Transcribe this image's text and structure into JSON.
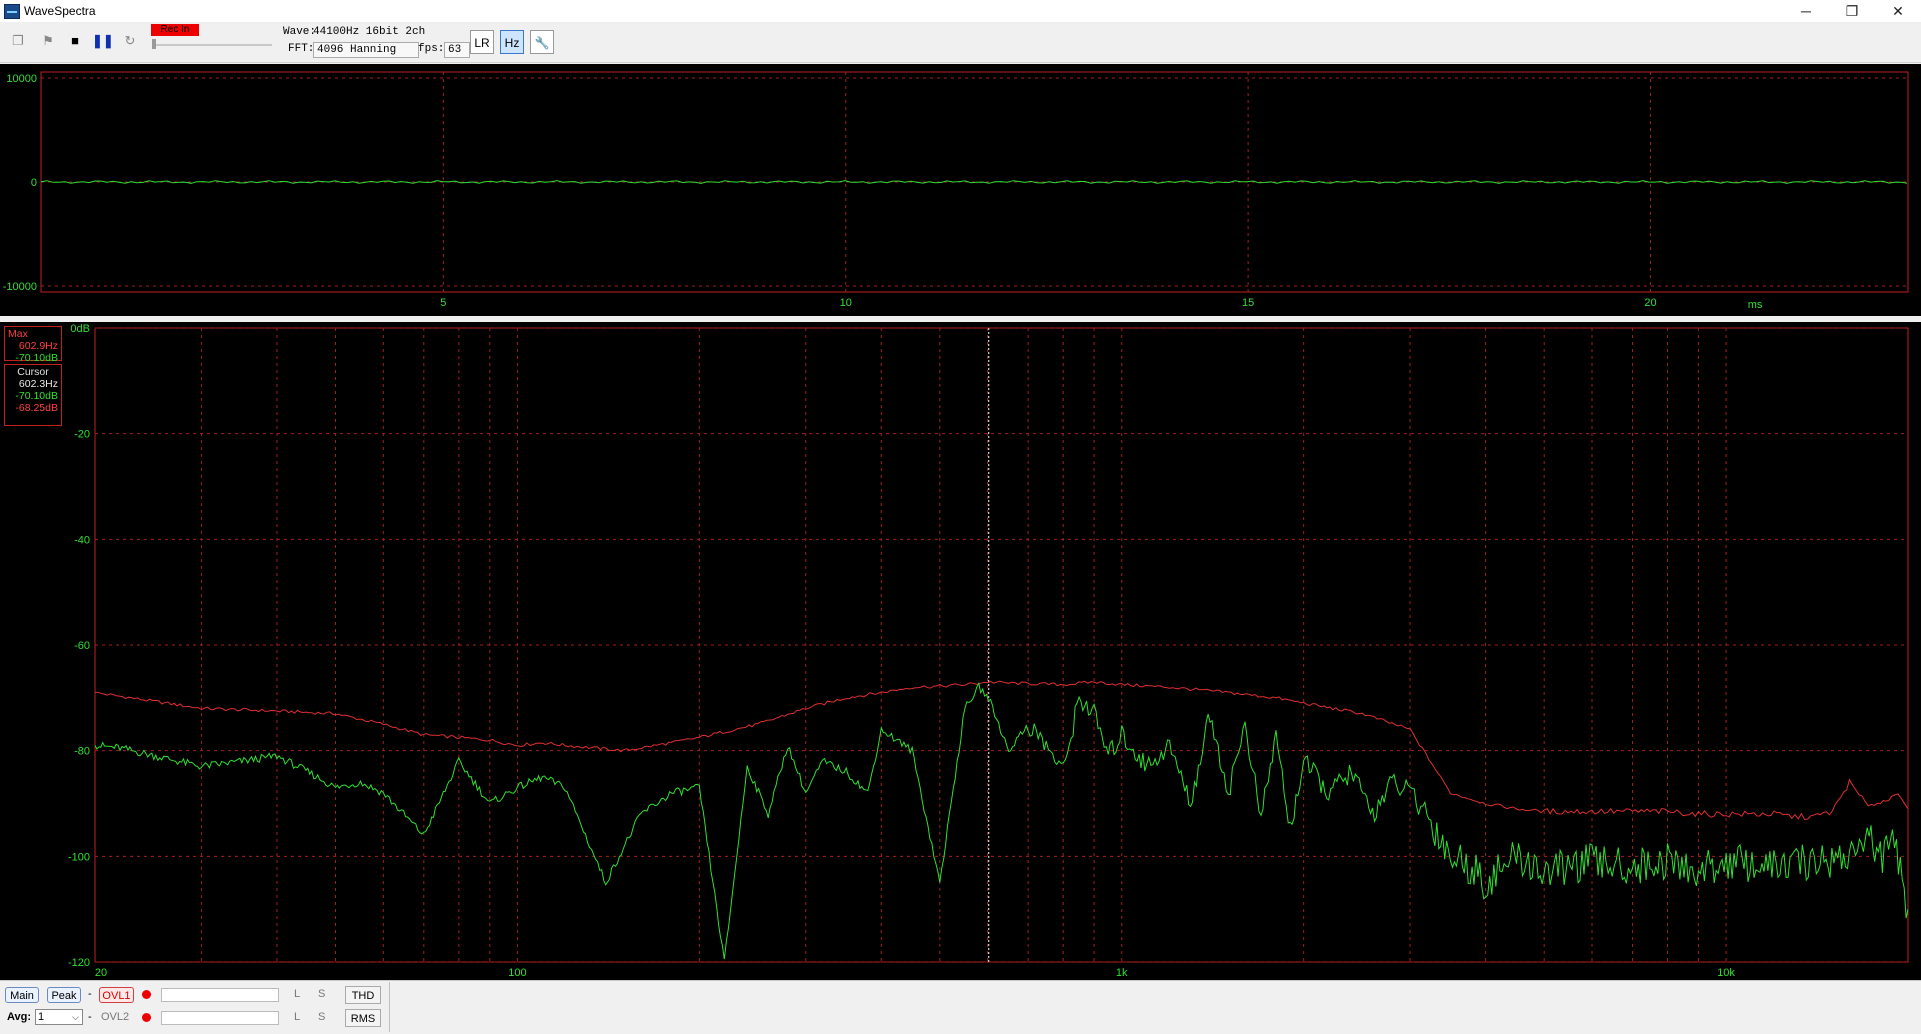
{
  "window": {
    "title": "WaveSpectra",
    "minimize_glyph": "─",
    "maximize_glyph": "❐",
    "close_glyph": "✕"
  },
  "toolbar": {
    "rec_label": "Rec In",
    "wave_label": "Wave:",
    "wave_value": "44100Hz 16bit 2ch",
    "fft_label": "FFT:",
    "fft_value": "4096 Hanning",
    "fps_label": "fps:",
    "fps_value": "63",
    "lr_button": "LR",
    "hz_button": "Hz",
    "settings_button": "🔧",
    "icons": [
      "copy-icon",
      "flag-icon",
      "stop-icon",
      "pause-icon",
      "repeat-icon"
    ]
  },
  "wave_panel": {
    "y_ticks": [
      "10000",
      "0",
      "-10000"
    ],
    "x_ticks": [
      "5",
      "10",
      "15",
      "20"
    ],
    "x_unit": "ms"
  },
  "spectrum_panel": {
    "y_ticks": [
      "0dB",
      "-20",
      "-40",
      "-60",
      "-80",
      "-100",
      "-120"
    ],
    "x_ticks": [
      "20",
      "100",
      "1k",
      "10k"
    ]
  },
  "max_box": {
    "label": "Max",
    "freq": "602.9Hz",
    "level": "-70.10dB"
  },
  "cursor_box": {
    "label": "Cursor",
    "freq": "602.3Hz",
    "level_l": "-70.10dB",
    "level_r": "-68.25dB"
  },
  "statusbar": {
    "main_button": "Main",
    "peak_button": "Peak",
    "dash": "-",
    "ovl1": "OVL1",
    "ovl2": "OVL2",
    "l": "L",
    "s": "S",
    "thd_button": "THD",
    "rms_button": "RMS",
    "avg_label": "Avg:",
    "avg_value": "1"
  },
  "chart_data": {
    "type": "line",
    "xscale": "log",
    "xlim": [
      20,
      20000
    ],
    "ylim": [
      -120,
      0
    ],
    "grid": true,
    "series": [
      {
        "color": "#e03030",
        "x": [
          20,
          30,
          40,
          50,
          60,
          70,
          80,
          90,
          100,
          110,
          120,
          150,
          180,
          200,
          250,
          300,
          350,
          400,
          450,
          500,
          550,
          600,
          650,
          700,
          800,
          900,
          1000,
          1200,
          1500,
          1800,
          2000,
          2500,
          3000,
          3500,
          4000,
          4500,
          5000,
          6000,
          7000,
          8000,
          9000,
          10000,
          11000,
          12000,
          13000,
          14000,
          15000,
          16000,
          17000,
          18000,
          19000,
          20000
        ],
        "y": [
          -69,
          -72,
          -72.5,
          -73,
          -75,
          -77,
          -77.5,
          -78,
          -79,
          -78.5,
          -79,
          -80,
          -78.5,
          -77.5,
          -75,
          -72,
          -70,
          -69,
          -68,
          -67.8,
          -67.5,
          -67,
          -67.2,
          -67.3,
          -67.5,
          -67,
          -67.5,
          -68,
          -69,
          -70,
          -71,
          -73,
          -76,
          -88,
          -90,
          -91,
          -91.5,
          -91.5,
          -91.5,
          -91.5,
          -92,
          -92,
          -92,
          -92,
          -92.5,
          -92.5,
          -91.5,
          -86,
          -90,
          -90,
          -88,
          -91
        ]
      },
      {
        "color": "#30e030",
        "x": [
          20,
          22,
          30,
          35,
          40,
          45,
          50,
          55,
          60,
          70,
          80,
          90,
          100,
          110,
          120,
          140,
          160,
          180,
          200,
          220,
          240,
          260,
          280,
          300,
          320,
          350,
          380,
          400,
          450,
          500,
          550,
          580,
          602,
          650,
          700,
          750,
          800,
          850,
          900,
          950,
          1000,
          1100,
          1200,
          1300,
          1400,
          1500,
          1600,
          1700,
          1800,
          1900,
          2000,
          2200,
          2400,
          2600,
          2800,
          3000,
          3200,
          3500,
          3800,
          4000,
          4500,
          5000,
          6000,
          7000,
          8000,
          9000,
          10000,
          12000,
          14000,
          16000,
          17000,
          18000,
          19000,
          20000
        ],
        "y": [
          -79,
          -79.5,
          -83,
          -82,
          -81,
          -84,
          -87,
          -86,
          -88,
          -96,
          -82,
          -90,
          -87,
          -85,
          -87,
          -105,
          -92,
          -88,
          -87,
          -120,
          -83,
          -92,
          -79,
          -88,
          -82,
          -84,
          -88,
          -76,
          -80,
          -105,
          -72,
          -68,
          -70,
          -80,
          -75,
          -79,
          -84,
          -70,
          -73,
          -81,
          -77,
          -83,
          -79,
          -90,
          -73,
          -88,
          -75,
          -93,
          -77,
          -95,
          -82,
          -88,
          -84,
          -92,
          -86,
          -88,
          -92,
          -100,
          -102,
          -105,
          -100,
          -103,
          -101,
          -102,
          -101,
          -103,
          -101,
          -102,
          -101,
          -100,
          -96,
          -100,
          -98,
          -110
        ]
      }
    ]
  }
}
